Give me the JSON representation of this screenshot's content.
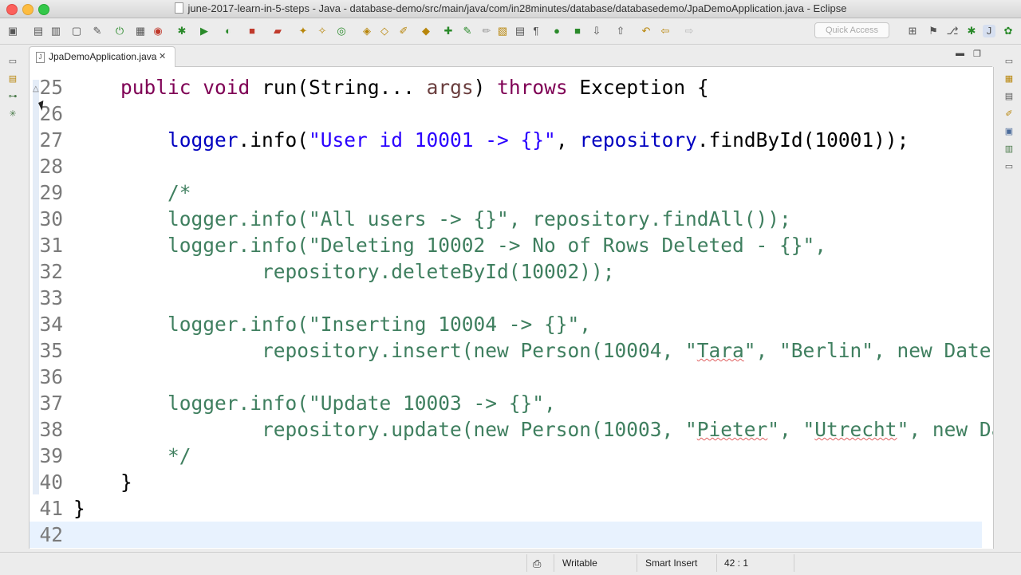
{
  "window": {
    "title": "june-2017-learn-in-5-steps - Java - database-demo/src/main/java/com/in28minutes/database/databasedemo/JpaDemoApplication.java - Eclipse"
  },
  "toolbar": {
    "quick_access_placeholder": "Quick Access"
  },
  "editor_tab": {
    "label": "JpaDemoApplication.java",
    "close": "✕",
    "java_badge": "J"
  },
  "code": {
    "lines": [
      {
        "n": "25",
        "tokens": [
          {
            "t": "    "
          },
          {
            "t": "public",
            "c": "kw"
          },
          {
            "t": " "
          },
          {
            "t": "void",
            "c": "kw"
          },
          {
            "t": " run(String... "
          },
          {
            "t": "args",
            "c": "param"
          },
          {
            "t": ") "
          },
          {
            "t": "throws",
            "c": "kw"
          },
          {
            "t": " Exception {"
          }
        ]
      },
      {
        "n": "26",
        "tokens": []
      },
      {
        "n": "27",
        "tokens": [
          {
            "t": "        "
          },
          {
            "t": "logger",
            "c": "fld"
          },
          {
            "t": ".info("
          },
          {
            "t": "\"User id 10001 -> {}\"",
            "c": "str"
          },
          {
            "t": ", "
          },
          {
            "t": "repository",
            "c": "fld"
          },
          {
            "t": ".findById(10001));"
          }
        ]
      },
      {
        "n": "28",
        "tokens": []
      },
      {
        "n": "29",
        "tokens": [
          {
            "t": "        "
          },
          {
            "t": "/*",
            "c": "cm"
          }
        ]
      },
      {
        "n": "30",
        "tokens": [
          {
            "t": "        logger.info(\"All users -> {}\", repository.findAll());",
            "c": "cm"
          }
        ]
      },
      {
        "n": "31",
        "tokens": [
          {
            "t": "        logger.info(\"Deleting 10002 -> No of Rows Deleted - {}\",",
            "c": "cm"
          }
        ]
      },
      {
        "n": "32",
        "tokens": [
          {
            "t": "                repository.deleteById(10002));",
            "c": "cm"
          }
        ]
      },
      {
        "n": "33",
        "tokens": []
      },
      {
        "n": "34",
        "tokens": [
          {
            "t": "        logger.info(\"Inserting 10004 -> {}\",",
            "c": "cm"
          }
        ]
      },
      {
        "n": "35",
        "tokens": [
          {
            "t": "                repository.insert(new Person(10004, \"",
            "c": "cm"
          },
          {
            "t": "Tara",
            "c": "cm squig"
          },
          {
            "t": "\", \"Berlin\", new Date(",
            "c": "cm"
          }
        ]
      },
      {
        "n": "36",
        "tokens": []
      },
      {
        "n": "37",
        "tokens": [
          {
            "t": "        logger.info(\"Update 10003 -> {}\",",
            "c": "cm"
          }
        ]
      },
      {
        "n": "38",
        "tokens": [
          {
            "t": "                repository.update(new Person(10003, \"",
            "c": "cm"
          },
          {
            "t": "Pieter",
            "c": "cm squig"
          },
          {
            "t": "\", \"",
            "c": "cm"
          },
          {
            "t": "Utrecht",
            "c": "cm squig"
          },
          {
            "t": "\", new Da",
            "c": "cm"
          }
        ]
      },
      {
        "n": "39",
        "tokens": [
          {
            "t": "        */",
            "c": "cm"
          }
        ]
      },
      {
        "n": "40",
        "tokens": [
          {
            "t": "    }"
          }
        ]
      },
      {
        "n": "41",
        "tokens": [
          {
            "t": "}"
          }
        ]
      },
      {
        "n": "42",
        "tokens": []
      }
    ]
  },
  "status": {
    "writable": "Writable",
    "insert_mode": "Smart Insert",
    "position": "42 : 1"
  }
}
